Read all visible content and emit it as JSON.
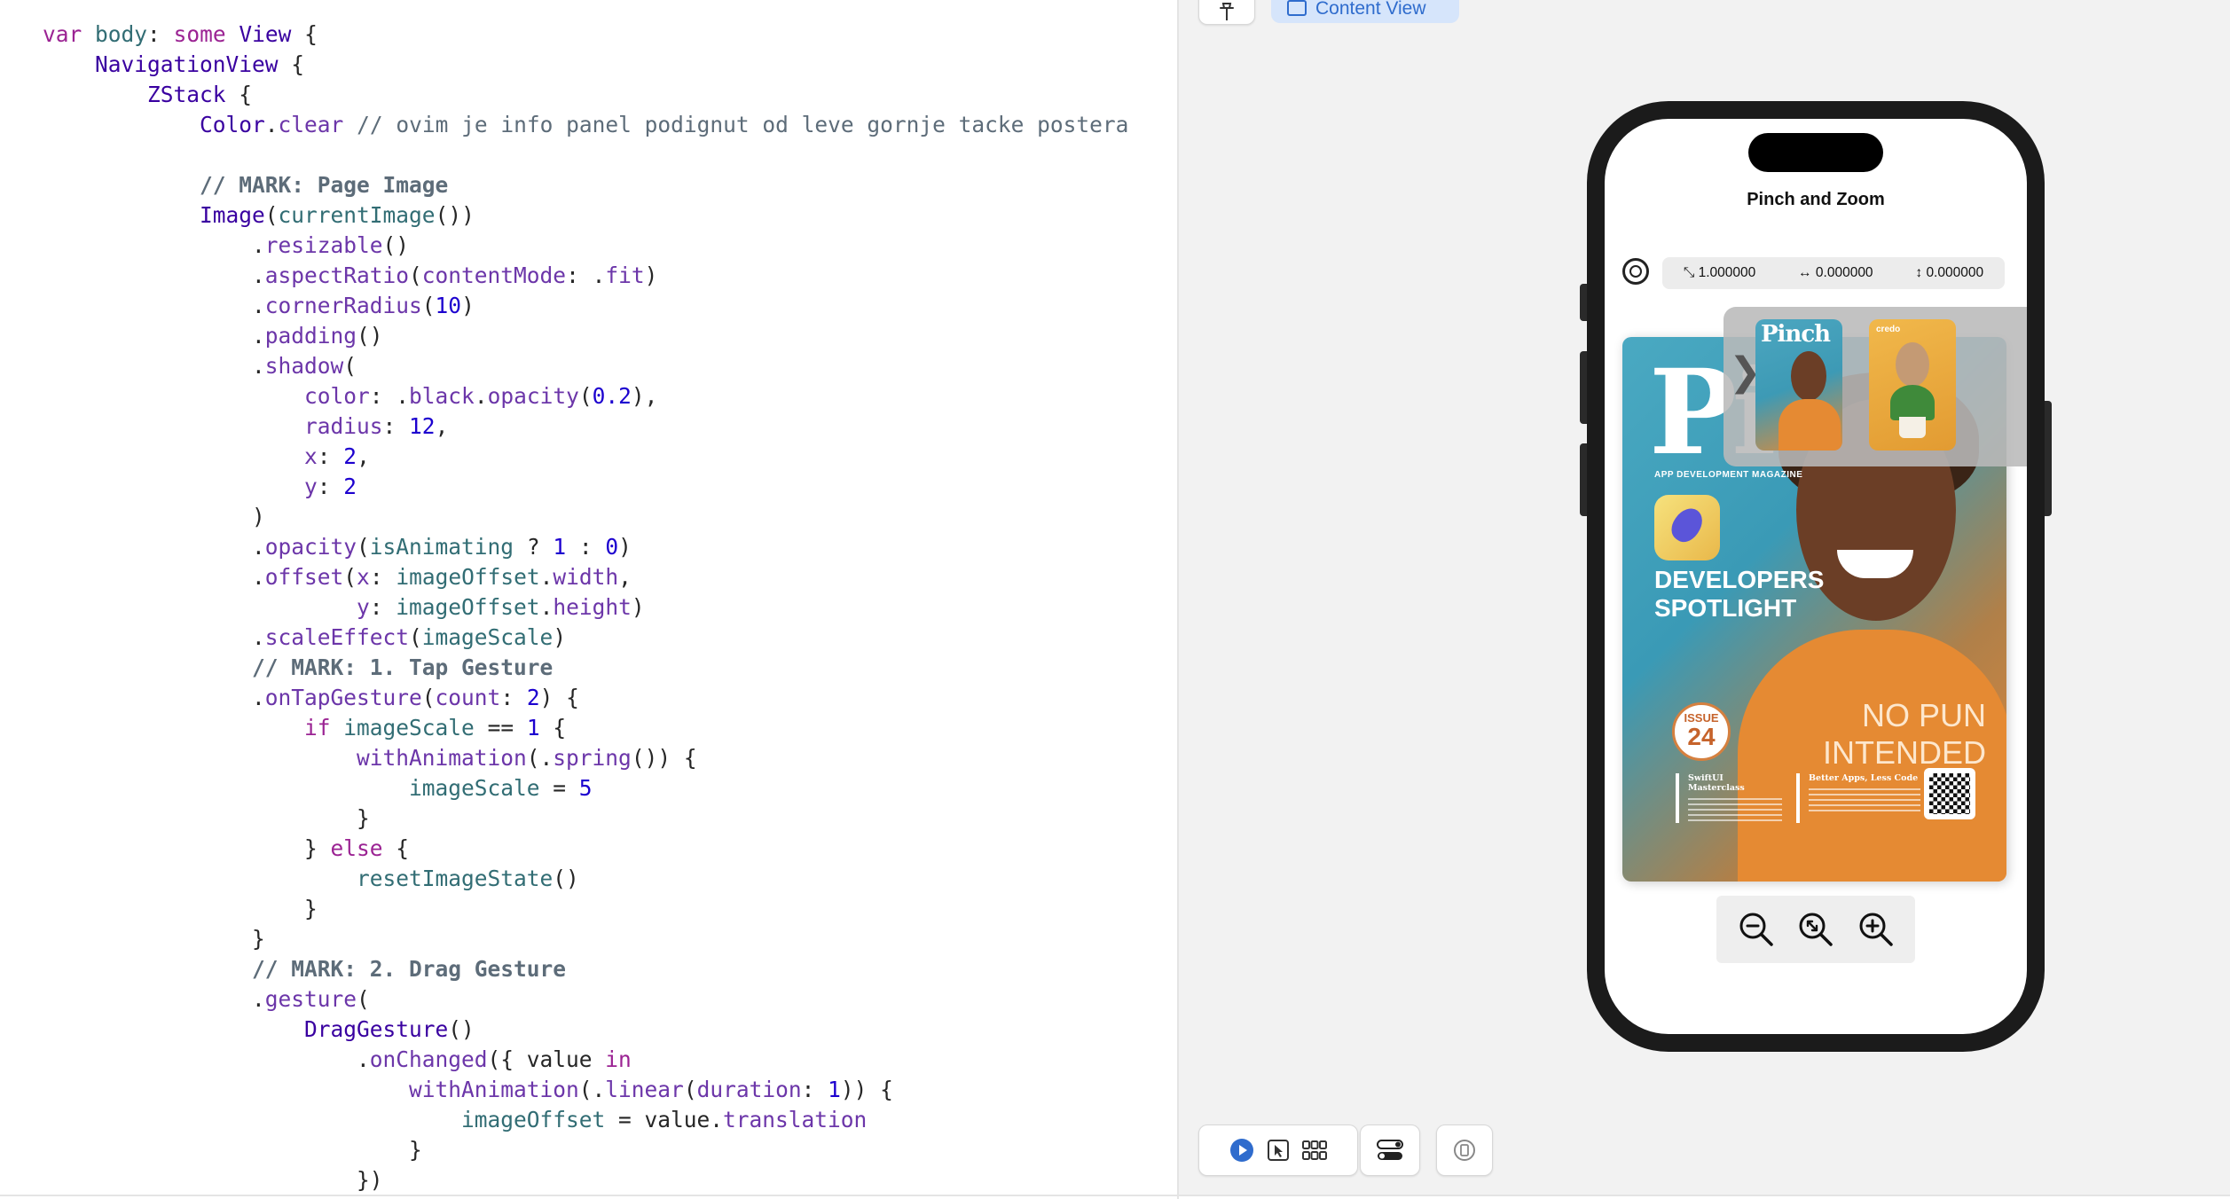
{
  "editor": {
    "lines": [
      [
        {
          "t": "var",
          "c": "kw"
        },
        {
          "t": " ",
          "c": "txt"
        },
        {
          "t": "body",
          "c": "var"
        },
        {
          "t": ": ",
          "c": "txt"
        },
        {
          "t": "some",
          "c": "kw"
        },
        {
          "t": " ",
          "c": "txt"
        },
        {
          "t": "View",
          "c": "typ"
        },
        {
          "t": " {",
          "c": "txt"
        }
      ],
      [
        {
          "t": "    ",
          "c": "txt"
        },
        {
          "t": "NavigationView",
          "c": "typ"
        },
        {
          "t": " {",
          "c": "txt"
        }
      ],
      [
        {
          "t": "        ",
          "c": "txt"
        },
        {
          "t": "ZStack",
          "c": "typ"
        },
        {
          "t": " {",
          "c": "txt"
        }
      ],
      [
        {
          "t": "            ",
          "c": "txt"
        },
        {
          "t": "Color",
          "c": "typ"
        },
        {
          "t": ".",
          "c": "txt"
        },
        {
          "t": "clear",
          "c": "mem"
        },
        {
          "t": " // ovim je info panel podignut od leve gornje tacke postera",
          "c": "cmt"
        }
      ],
      [],
      [
        {
          "t": "            ",
          "c": "txt"
        },
        {
          "t": "// MARK: Page Image",
          "c": "mark"
        }
      ],
      [
        {
          "t": "            ",
          "c": "txt"
        },
        {
          "t": "Image",
          "c": "typ"
        },
        {
          "t": "(",
          "c": "txt"
        },
        {
          "t": "currentImage",
          "c": "var"
        },
        {
          "t": "())",
          "c": "txt"
        }
      ],
      [
        {
          "t": "                .",
          "c": "txt"
        },
        {
          "t": "resizable",
          "c": "mem"
        },
        {
          "t": "()",
          "c": "txt"
        }
      ],
      [
        {
          "t": "                .",
          "c": "txt"
        },
        {
          "t": "aspectRatio",
          "c": "mem"
        },
        {
          "t": "(",
          "c": "txt"
        },
        {
          "t": "contentMode",
          "c": "mem"
        },
        {
          "t": ": .",
          "c": "txt"
        },
        {
          "t": "fit",
          "c": "mem"
        },
        {
          "t": ")",
          "c": "txt"
        }
      ],
      [
        {
          "t": "                .",
          "c": "txt"
        },
        {
          "t": "cornerRadius",
          "c": "mem"
        },
        {
          "t": "(",
          "c": "txt"
        },
        {
          "t": "10",
          "c": "num"
        },
        {
          "t": ")",
          "c": "txt"
        }
      ],
      [
        {
          "t": "                .",
          "c": "txt"
        },
        {
          "t": "padding",
          "c": "mem"
        },
        {
          "t": "()",
          "c": "txt"
        }
      ],
      [
        {
          "t": "                .",
          "c": "txt"
        },
        {
          "t": "shadow",
          "c": "mem"
        },
        {
          "t": "(",
          "c": "txt"
        }
      ],
      [
        {
          "t": "                    ",
          "c": "txt"
        },
        {
          "t": "color",
          "c": "mem"
        },
        {
          "t": ": .",
          "c": "txt"
        },
        {
          "t": "black",
          "c": "mem"
        },
        {
          "t": ".",
          "c": "txt"
        },
        {
          "t": "opacity",
          "c": "mem"
        },
        {
          "t": "(",
          "c": "txt"
        },
        {
          "t": "0.2",
          "c": "num"
        },
        {
          "t": "),",
          "c": "txt"
        }
      ],
      [
        {
          "t": "                    ",
          "c": "txt"
        },
        {
          "t": "radius",
          "c": "mem"
        },
        {
          "t": ": ",
          "c": "txt"
        },
        {
          "t": "12",
          "c": "num"
        },
        {
          "t": ",",
          "c": "txt"
        }
      ],
      [
        {
          "t": "                    ",
          "c": "txt"
        },
        {
          "t": "x",
          "c": "mem"
        },
        {
          "t": ": ",
          "c": "txt"
        },
        {
          "t": "2",
          "c": "num"
        },
        {
          "t": ",",
          "c": "txt"
        }
      ],
      [
        {
          "t": "                    ",
          "c": "txt"
        },
        {
          "t": "y",
          "c": "mem"
        },
        {
          "t": ": ",
          "c": "txt"
        },
        {
          "t": "2",
          "c": "num"
        }
      ],
      [
        {
          "t": "                )",
          "c": "txt"
        }
      ],
      [
        {
          "t": "                .",
          "c": "txt"
        },
        {
          "t": "opacity",
          "c": "mem"
        },
        {
          "t": "(",
          "c": "txt"
        },
        {
          "t": "isAnimating",
          "c": "var"
        },
        {
          "t": " ? ",
          "c": "txt"
        },
        {
          "t": "1",
          "c": "num"
        },
        {
          "t": " : ",
          "c": "txt"
        },
        {
          "t": "0",
          "c": "num"
        },
        {
          "t": ")",
          "c": "txt"
        }
      ],
      [
        {
          "t": "                .",
          "c": "txt"
        },
        {
          "t": "offset",
          "c": "mem"
        },
        {
          "t": "(",
          "c": "txt"
        },
        {
          "t": "x",
          "c": "mem"
        },
        {
          "t": ": ",
          "c": "txt"
        },
        {
          "t": "imageOffset",
          "c": "var"
        },
        {
          "t": ".",
          "c": "txt"
        },
        {
          "t": "width",
          "c": "mem"
        },
        {
          "t": ",",
          "c": "txt"
        }
      ],
      [
        {
          "t": "                        ",
          "c": "txt"
        },
        {
          "t": "y",
          "c": "mem"
        },
        {
          "t": ": ",
          "c": "txt"
        },
        {
          "t": "imageOffset",
          "c": "var"
        },
        {
          "t": ".",
          "c": "txt"
        },
        {
          "t": "height",
          "c": "mem"
        },
        {
          "t": ")",
          "c": "txt"
        }
      ],
      [
        {
          "t": "                .",
          "c": "txt"
        },
        {
          "t": "scaleEffect",
          "c": "mem"
        },
        {
          "t": "(",
          "c": "txt"
        },
        {
          "t": "imageScale",
          "c": "var"
        },
        {
          "t": ")",
          "c": "txt"
        }
      ],
      [
        {
          "t": "                ",
          "c": "txt"
        },
        {
          "t": "// MARK: 1. Tap Gesture",
          "c": "mark"
        }
      ],
      [
        {
          "t": "                .",
          "c": "txt"
        },
        {
          "t": "onTapGesture",
          "c": "mem"
        },
        {
          "t": "(",
          "c": "txt"
        },
        {
          "t": "count",
          "c": "mem"
        },
        {
          "t": ": ",
          "c": "txt"
        },
        {
          "t": "2",
          "c": "num"
        },
        {
          "t": ") {",
          "c": "txt"
        }
      ],
      [
        {
          "t": "                    ",
          "c": "txt"
        },
        {
          "t": "if",
          "c": "kw"
        },
        {
          "t": " ",
          "c": "txt"
        },
        {
          "t": "imageScale",
          "c": "var"
        },
        {
          "t": " == ",
          "c": "txt"
        },
        {
          "t": "1",
          "c": "num"
        },
        {
          "t": " {",
          "c": "txt"
        }
      ],
      [
        {
          "t": "                        ",
          "c": "txt"
        },
        {
          "t": "withAnimation",
          "c": "mem"
        },
        {
          "t": "(.",
          "c": "txt"
        },
        {
          "t": "spring",
          "c": "mem"
        },
        {
          "t": "()) {",
          "c": "txt"
        }
      ],
      [
        {
          "t": "                            ",
          "c": "txt"
        },
        {
          "t": "imageScale",
          "c": "var"
        },
        {
          "t": " = ",
          "c": "txt"
        },
        {
          "t": "5",
          "c": "num"
        }
      ],
      [
        {
          "t": "                        }",
          "c": "txt"
        }
      ],
      [
        {
          "t": "                    } ",
          "c": "txt"
        },
        {
          "t": "else",
          "c": "kw"
        },
        {
          "t": " {",
          "c": "txt"
        }
      ],
      [
        {
          "t": "                        ",
          "c": "txt"
        },
        {
          "t": "resetImageState",
          "c": "var"
        },
        {
          "t": "()",
          "c": "txt"
        }
      ],
      [
        {
          "t": "                    }",
          "c": "txt"
        }
      ],
      [
        {
          "t": "                }",
          "c": "txt"
        }
      ],
      [
        {
          "t": "                ",
          "c": "txt"
        },
        {
          "t": "// MARK: 2. Drag Gesture",
          "c": "mark"
        }
      ],
      [
        {
          "t": "                .",
          "c": "txt"
        },
        {
          "t": "gesture",
          "c": "mem"
        },
        {
          "t": "(",
          "c": "txt"
        }
      ],
      [
        {
          "t": "                    ",
          "c": "txt"
        },
        {
          "t": "DragGesture",
          "c": "typ"
        },
        {
          "t": "()",
          "c": "txt"
        }
      ],
      [
        {
          "t": "                        .",
          "c": "txt"
        },
        {
          "t": "onChanged",
          "c": "mem"
        },
        {
          "t": "({ value ",
          "c": "txt"
        },
        {
          "t": "in",
          "c": "kw"
        }
      ],
      [
        {
          "t": "                            ",
          "c": "txt"
        },
        {
          "t": "withAnimation",
          "c": "mem"
        },
        {
          "t": "(.",
          "c": "txt"
        },
        {
          "t": "linear",
          "c": "mem"
        },
        {
          "t": "(",
          "c": "txt"
        },
        {
          "t": "duration",
          "c": "mem"
        },
        {
          "t": ": ",
          "c": "txt"
        },
        {
          "t": "1",
          "c": "num"
        },
        {
          "t": ")) {",
          "c": "txt"
        }
      ],
      [
        {
          "t": "                                ",
          "c": "txt"
        },
        {
          "t": "imageOffset",
          "c": "var"
        },
        {
          "t": " = value.",
          "c": "txt"
        },
        {
          "t": "translation",
          "c": "mem"
        }
      ],
      [
        {
          "t": "                            }",
          "c": "txt"
        }
      ],
      [
        {
          "t": "                        })",
          "c": "txt"
        }
      ]
    ]
  },
  "preview": {
    "tab_label": "Content View",
    "icons": {
      "pin": "pin-icon",
      "tab": "content-view-icon",
      "live": "play-icon",
      "selectable": "select-cursor-icon",
      "variants": "grid-icon",
      "device_settings": "device-settings-icon",
      "device": "device-icon"
    }
  },
  "app": {
    "nav_title": "Pinch and Zoom",
    "info": {
      "scale": "1.000000",
      "offset_x": "0.000000",
      "offset_y": "0.000000"
    },
    "poster": {
      "title": "Pi",
      "magazine": "APP DEVELOPMENT MAGAZINE",
      "headline": "DEVELOPERS SPOTLIGHT",
      "issue_word": "ISSUE",
      "issue_number": "24",
      "tagline": "NO PUN INTENDED",
      "column_1": "SwiftUI Masterclass",
      "column_2": "Better Apps, Less Code"
    },
    "drawer": {
      "thumb_1_title": "Pinch",
      "thumb_2_title": "credo"
    },
    "controls": [
      "zoom-out-icon",
      "reset-zoom-icon",
      "zoom-in-icon"
    ]
  },
  "colors": {
    "keyword": "#9b2393",
    "type": "#3900a0",
    "member": "#6c36a9",
    "comment": "#5d6c79",
    "number": "#1c00cf",
    "variable": "#326d74",
    "accent": "#2f6ccd"
  }
}
